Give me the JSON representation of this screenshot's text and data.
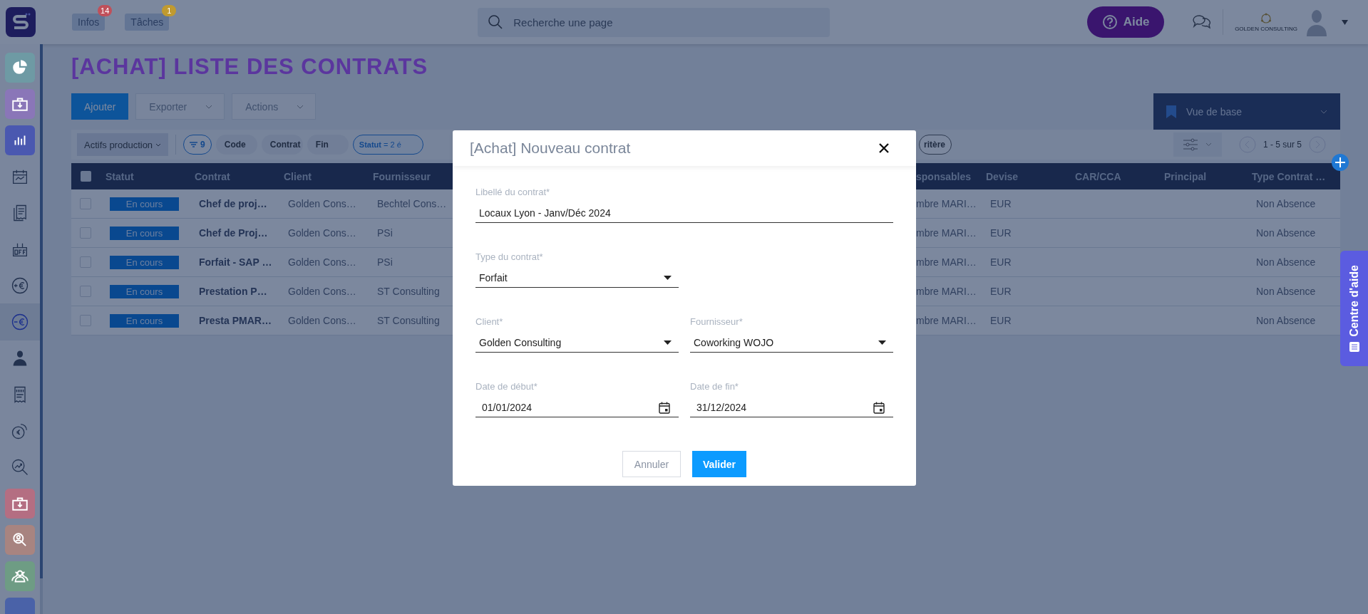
{
  "topbar": {
    "notifications": [
      {
        "label": "Infos",
        "count": "14",
        "color": "#c0505a"
      },
      {
        "label": "Tâches",
        "count": "1",
        "color": "#c09a30"
      }
    ],
    "search": {
      "placeholder": "Recherche une page"
    },
    "help_button": "Aide",
    "company": "GOLDEN CONSULTING"
  },
  "sidebar": {
    "items": [
      {
        "kind": "tile",
        "color": "#6e9aa4",
        "selected": false
      },
      {
        "kind": "tile",
        "color": "#8a76b8",
        "selected": false
      },
      {
        "kind": "tile",
        "color": "#4a58b0",
        "selected": false
      },
      {
        "kind": "plain",
        "selected": false
      },
      {
        "kind": "plain",
        "selected": false
      },
      {
        "kind": "plain",
        "selected": false
      },
      {
        "kind": "plain",
        "selected": false
      },
      {
        "kind": "plain",
        "selected": true
      },
      {
        "kind": "plain",
        "selected": false
      },
      {
        "kind": "plain",
        "selected": false
      },
      {
        "kind": "plain",
        "selected": false
      },
      {
        "kind": "plain",
        "selected": false
      },
      {
        "kind": "tile",
        "color": "#b46e82",
        "selected": false
      },
      {
        "kind": "tile",
        "color": "#a88480",
        "selected": false
      },
      {
        "kind": "tile",
        "color": "#6e9c84",
        "selected": false
      },
      {
        "kind": "tile",
        "color": "#4a62a8",
        "selected": false
      }
    ]
  },
  "page": {
    "title": "[ACHAT] LISTE DES CONTRATS",
    "toolbar": [
      {
        "label": "Ajouter",
        "kind": "primary"
      },
      {
        "label": "Exporter",
        "kind": "dropdown"
      },
      {
        "label": "Actions",
        "kind": "dropdown"
      }
    ],
    "view_selector": "Vue de base"
  },
  "filters": {
    "preset": "Actifs production",
    "chips": [
      {
        "kind": "count",
        "label": "9"
      },
      {
        "kind": "plain",
        "label": "Code"
      },
      {
        "kind": "plain",
        "label": "Contrat"
      },
      {
        "kind": "plain",
        "label": "Fin"
      },
      {
        "kind": "active",
        "label": "**Statut** = 2 é"
      }
    ],
    "hidden_chip": "ritère",
    "pagination": "1 - 5 sur 5"
  },
  "table": {
    "all_selected": false,
    "columns": [
      "Statut",
      "Contrat",
      "Client",
      "Fournisseur",
      "sponsables",
      "Devise",
      "CAR/CCA",
      "Principal",
      "Type Contrat …"
    ],
    "rows": [
      {
        "selected": false,
        "status": "En cours",
        "contrat": "Chef de proj…",
        "client": "Golden Cons…",
        "fournisseur": "Bechtel Cons…",
        "column_5": "mbre MARI…",
        "devise": "EUR",
        "type_contrat": "Non Absence"
      },
      {
        "selected": false,
        "status": "En cours",
        "contrat": "Chef de Proj…",
        "client": "Golden Cons…",
        "fournisseur": "PSi",
        "column_5": "mbre MARI…",
        "devise": "EUR",
        "type_contrat": "Non Absence"
      },
      {
        "selected": false,
        "status": "En cours",
        "contrat": "Forfait - SAP …",
        "client": "Golden Cons…",
        "fournisseur": "PSi",
        "column_5": "mbre MARI…",
        "devise": "EUR",
        "type_contrat": "Non Absence"
      },
      {
        "selected": false,
        "status": "En cours",
        "contrat": "Prestation P…",
        "client": "Golden Cons…",
        "fournisseur": "ST Consulting",
        "column_5": "mbre MARI…",
        "devise": "EUR",
        "type_contrat": "Non Absence"
      },
      {
        "selected": false,
        "status": "En cours",
        "contrat": "Presta PMAR…",
        "client": "Golden Cons…",
        "fournisseur": "ST Consulting",
        "column_5": "mbre MARI…",
        "devise": "EUR",
        "type_contrat": "Non Absence"
      }
    ]
  },
  "modal": {
    "title": "[Achat] Nouveau contrat",
    "rows": [
      [
        {
          "kind": "text",
          "label": "Libellé du contrat*",
          "value": "Locaux Lyon - Janv/Déc 2024"
        }
      ],
      [
        {
          "kind": "select",
          "label": "Type du contrat*",
          "value": "Forfait"
        }
      ],
      [
        {
          "kind": "select",
          "label": "Client*",
          "value": "Golden Consulting"
        },
        {
          "kind": "select",
          "label": "Fournisseur*",
          "value": "Coworking WOJO"
        }
      ],
      [
        {
          "kind": "date",
          "label": "Date de début*",
          "value": "01/01/2024"
        },
        {
          "kind": "date",
          "label": "Date de fin*",
          "value": "31/12/2024"
        }
      ]
    ],
    "buttons": [
      {
        "label": "Annuler",
        "kind": "secondary"
      },
      {
        "label": "Valider",
        "kind": "primary"
      }
    ]
  },
  "help_tab": "Centre d'aide"
}
